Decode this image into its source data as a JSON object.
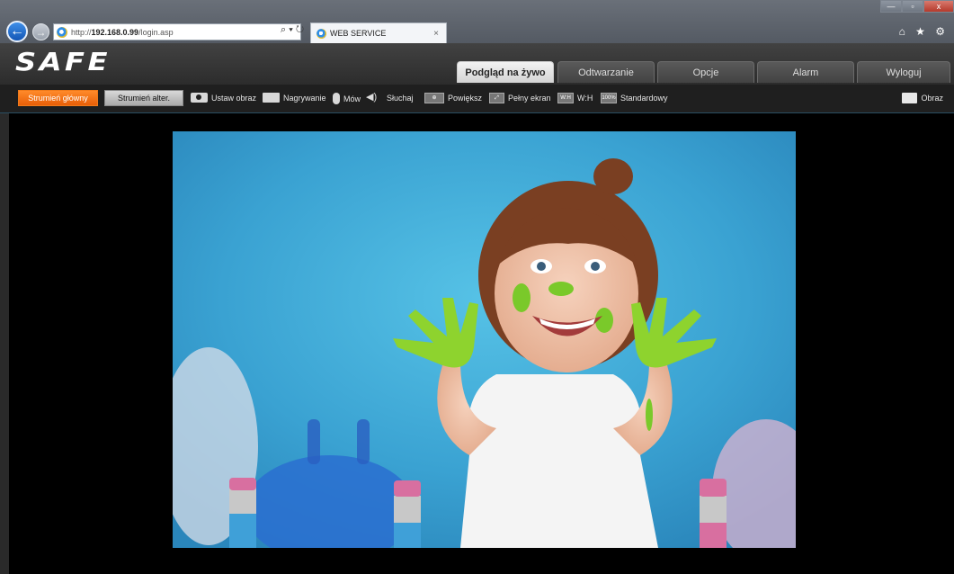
{
  "browser": {
    "url_prefix": "http://",
    "url_host": "192.168.0.99",
    "url_path": "/login.asp",
    "address_tools": "⌕ ▾ ↻",
    "tab_title": "WEB SERVICE",
    "tab_close": "×",
    "window_buttons": [
      "—",
      "▫",
      "x"
    ],
    "right_icons": "⌂ ★ ⚙"
  },
  "app": {
    "logo": "SAFE",
    "tabs": [
      {
        "label": "Podgląd na żywo",
        "active": true
      },
      {
        "label": "Odtwarzanie",
        "active": false
      },
      {
        "label": "Opcje",
        "active": false
      },
      {
        "label": "Alarm",
        "active": false
      },
      {
        "label": "Wyloguj",
        "active": false
      }
    ]
  },
  "toolbar": {
    "stream_main": "Strumień główny",
    "stream_alt": "Strumień alter.",
    "set_image": "Ustaw obraz",
    "recording": "Nagrywanie",
    "talk": "Mów",
    "listen": "Słuchaj",
    "zoom": "Powiększ",
    "fullscreen": "Pełny ekran",
    "wh_icon": "W:H",
    "wh": "W:H",
    "standard_icon": "100%",
    "standard": "Standardowy",
    "image": "Obraz"
  },
  "colors": {
    "accent": "#f06a12",
    "active_tab": "#e6e6e6",
    "video_bg": "#3aa4d4"
  }
}
